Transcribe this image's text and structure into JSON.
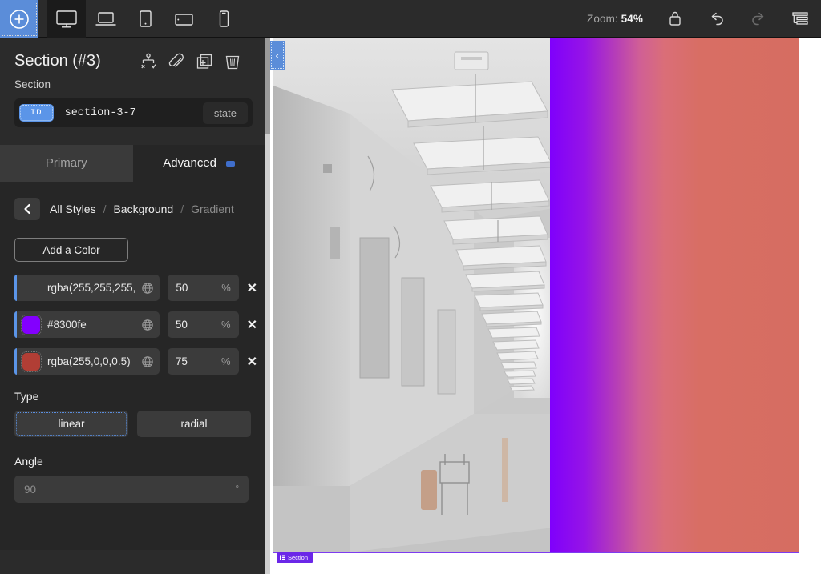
{
  "toolbar": {
    "add_label": "add-element",
    "devices": [
      {
        "name": "desktop",
        "label": "Desktop",
        "active": true
      },
      {
        "name": "laptop",
        "label": "Laptop",
        "active": false
      },
      {
        "name": "tablet-portrait",
        "label": "Tablet",
        "active": false
      },
      {
        "name": "tablet-landscape",
        "label": "Tablet Landscape",
        "active": false
      },
      {
        "name": "mobile",
        "label": "Mobile",
        "active": false
      }
    ],
    "zoom_prefix": "Zoom:",
    "zoom_value": "54%",
    "lock_label": "Lock",
    "undo_label": "Undo",
    "redo_label": "Redo",
    "panels_label": "Panels"
  },
  "panel": {
    "title": "Section (#3)",
    "header_actions": [
      "conditions",
      "link",
      "duplicate",
      "delete"
    ],
    "sub_label": "Section",
    "id_badge": "ID",
    "id_value": "section-3-7",
    "state_label": "state",
    "tabs": [
      {
        "label": "Primary",
        "active": false
      },
      {
        "label": "Advanced",
        "active": true
      }
    ],
    "breadcrumb": {
      "back_label": "Back",
      "items": [
        {
          "label": "All Styles",
          "muted": false
        },
        {
          "label": "Background",
          "muted": false
        },
        {
          "label": "Gradient",
          "muted": true
        }
      ],
      "separator": "/"
    },
    "add_color_label": "Add a Color",
    "colors": [
      {
        "value": "rgba(255,255,255,",
        "swatch": "transparent",
        "stop": "50",
        "unit": "%",
        "remove": "✕"
      },
      {
        "value": "#8300fe",
        "swatch": "#8300fe",
        "stop": "50",
        "unit": "%",
        "remove": "✕"
      },
      {
        "value": "rgba(255,0,0,0.5)",
        "swatch": "#b13e35",
        "stop": "75",
        "unit": "%",
        "remove": "✕"
      }
    ],
    "type_label": "Type",
    "type_options": [
      {
        "label": "linear",
        "selected": true
      },
      {
        "label": "radial",
        "selected": false
      }
    ],
    "angle_label": "Angle",
    "angle_placeholder": "90",
    "angle_unit": "°"
  },
  "canvas": {
    "collapse_chevron": "‹",
    "section_badge": "Section",
    "selection_color": "#7d3bf0",
    "gradient_start": "#8300fe",
    "gradient_end": "#d66d61"
  }
}
